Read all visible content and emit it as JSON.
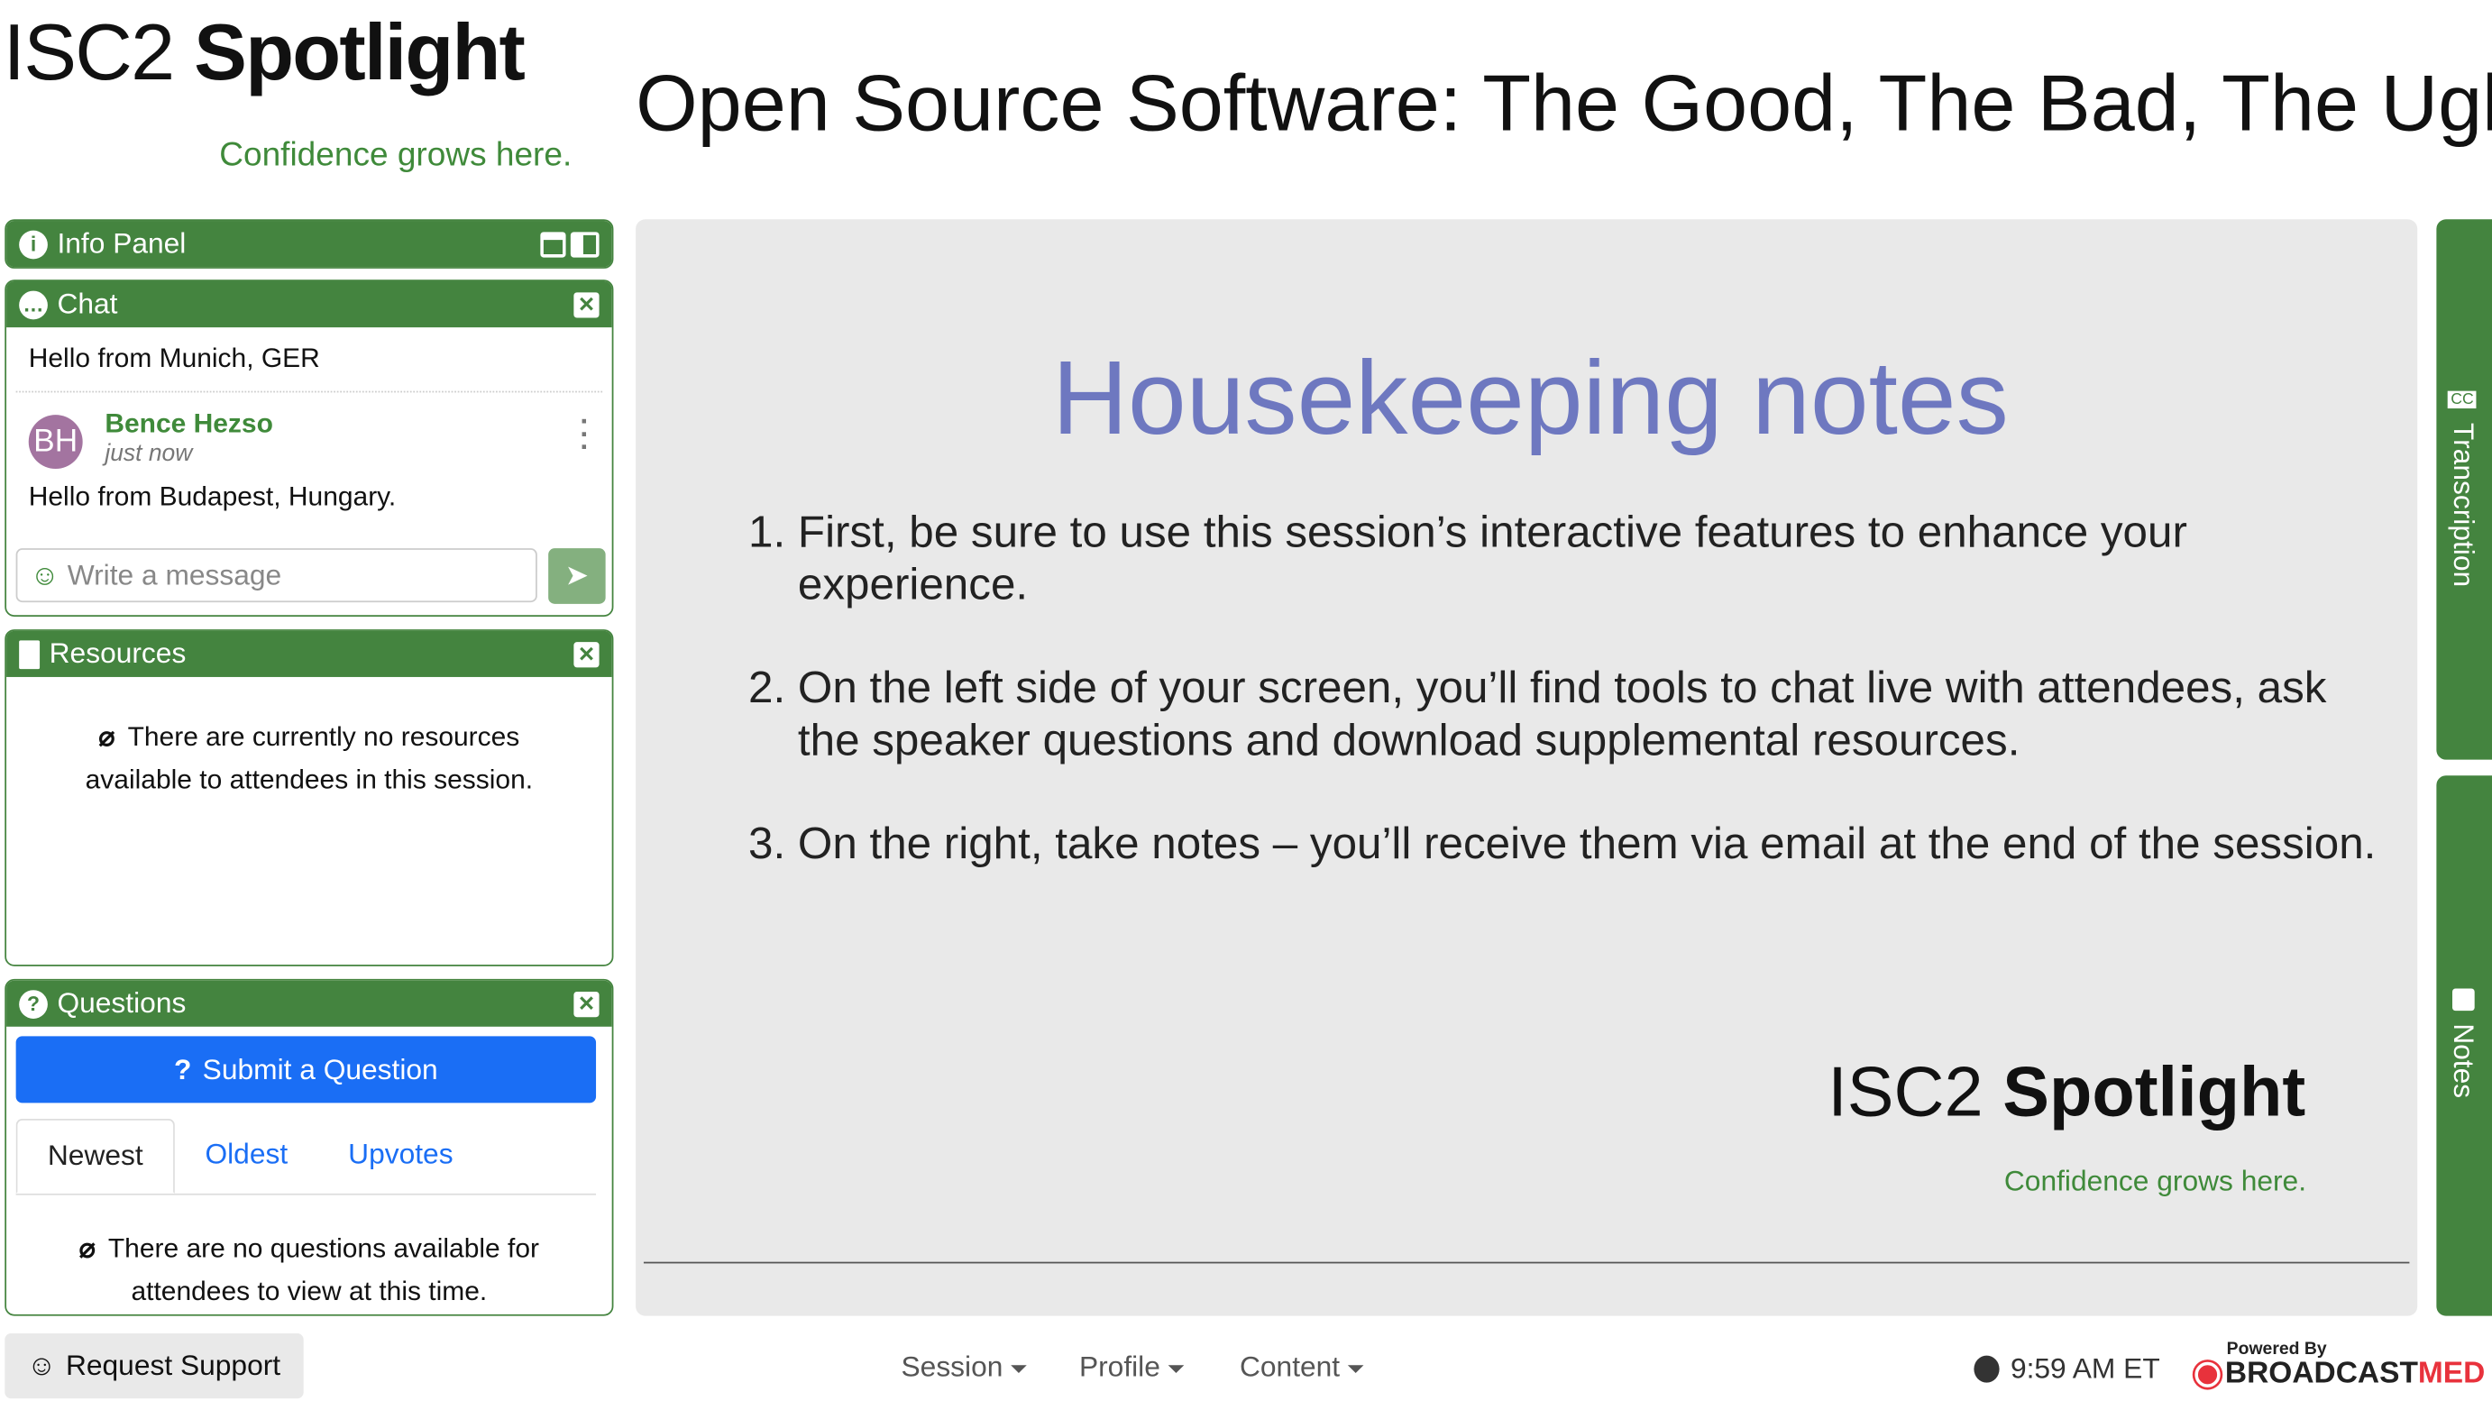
{
  "header": {
    "logo_text": "ISC2 Spotlight",
    "logo_tagline": "Confidence grows here.",
    "title": "Open Source Software: The Good, The Bad, The Ugly"
  },
  "info_panel": {
    "title": "Info Panel"
  },
  "chat": {
    "title": "Chat",
    "messages": [
      {
        "text": "Hello from Munich, GER"
      },
      {
        "initials": "BH",
        "author": "Bence Hezso",
        "time": "just now",
        "text": "Hello from Budapest, Hungary."
      }
    ],
    "input_placeholder": "Write a message"
  },
  "resources": {
    "title": "Resources",
    "empty": "There are currently no resources available to attendees in this session."
  },
  "questions": {
    "title": "Questions",
    "submit_label": "Submit a Question",
    "tabs": [
      "Newest",
      "Oldest",
      "Upvotes"
    ],
    "empty": "There are no questions available for attendees to view at this time."
  },
  "slide": {
    "title": "Housekeeping notes",
    "items": [
      "First, be sure to use this session’s interactive features to enhance your experience.",
      "On the left side of your screen, you’ll find tools to chat live with attendees, ask the speaker questions and download supplemental resources.",
      "On the right, take notes – you’ll receive them via email at the end of the session."
    ],
    "logo_text": "ISC2 Spotlight",
    "logo_tagline": "Confidence grows here."
  },
  "side_tabs": {
    "transcription": "Transcription",
    "notes": "Notes"
  },
  "footer": {
    "support": "Request Support",
    "menus": [
      "Session",
      "Profile",
      "Content"
    ],
    "time": "9:59 AM ET",
    "powered_by": "Powered By",
    "brand_a": "BROADCAST",
    "brand_b": "MED"
  },
  "colors": {
    "green": "#44843f",
    "blue": "#1a6ef5",
    "slide_title": "#6e78c0",
    "brand_red": "#e8323c"
  }
}
